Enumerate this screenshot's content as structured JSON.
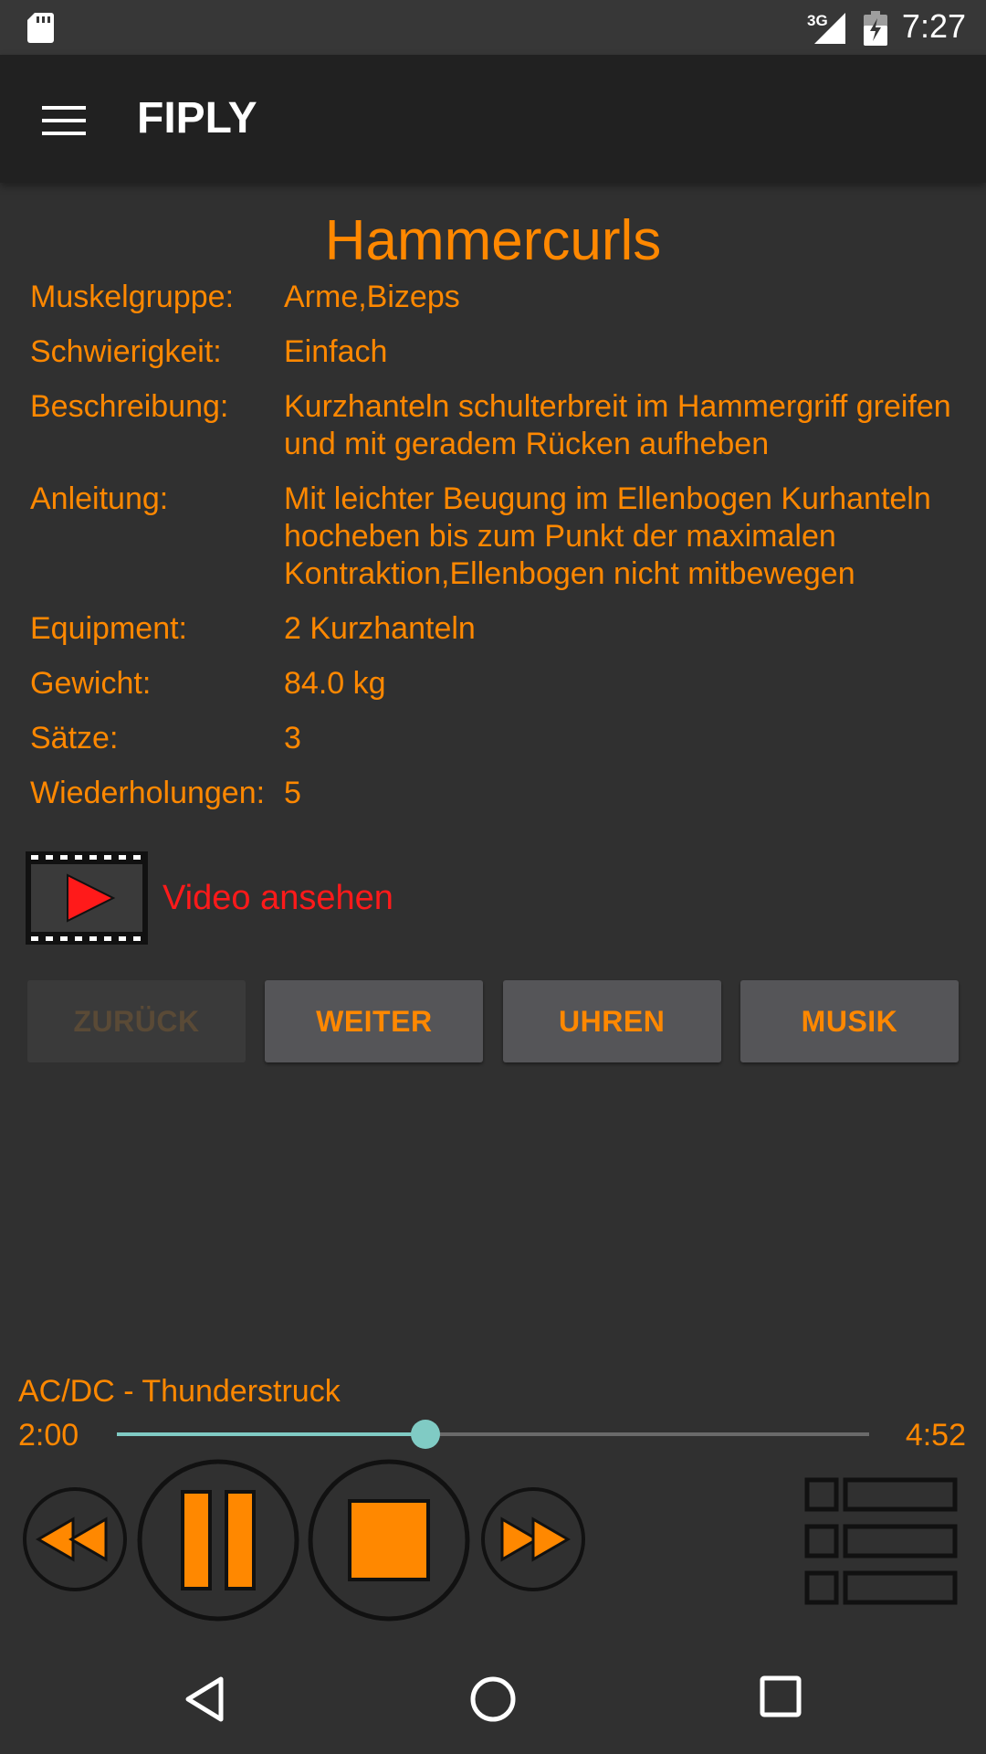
{
  "status_bar": {
    "network": "3G",
    "time": "7:27"
  },
  "app_bar": {
    "title": "FIPLY",
    "menu_icon": "hamburger-menu-icon"
  },
  "exercise": {
    "title": "Hammercurls",
    "details": [
      {
        "label": "Muskelgruppe:",
        "value": "Arme,Bizeps"
      },
      {
        "label": "Schwierigkeit:",
        "value": "Einfach"
      },
      {
        "label": "Beschreibung:",
        "value": "Kurzhanteln schulterbreit im Hammergriff greifen und mit geradem Rücken aufheben"
      },
      {
        "label": "Anleitung:",
        "value": "Mit leichter Beugung im Ellenbogen Kurhanteln hocheben bis zum Punkt der maximalen Kontraktion,Ellenbogen nicht mitbewegen"
      },
      {
        "label": "Equipment:",
        "value": "2 Kurzhanteln"
      },
      {
        "label": "Gewicht:",
        "value": "84.0 kg"
      },
      {
        "label": "Sätze:",
        "value": "3"
      },
      {
        "label": "Wiederholungen:",
        "value": "5"
      }
    ]
  },
  "video": {
    "label": "Video ansehen",
    "icon": "film-play-icon"
  },
  "buttons": {
    "back": "ZURÜCK",
    "next": "WEITER",
    "clocks": "UHREN",
    "music": "MUSIK"
  },
  "player": {
    "track": "AC/DC - Thunderstruck",
    "elapsed": "2:00",
    "total": "4:52",
    "progress": 0.41
  },
  "colors": {
    "accent": "#FF8800",
    "video_red": "#FF1A1A",
    "seek": "#80CBC4",
    "background": "#303030",
    "toolbar": "#212121"
  }
}
